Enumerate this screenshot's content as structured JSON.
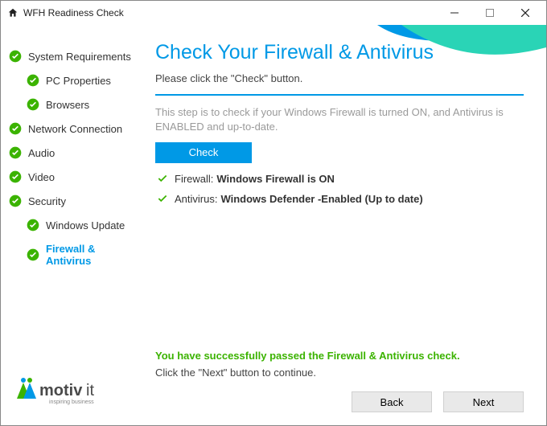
{
  "window": {
    "title": "WFH Readiness Check"
  },
  "sidebar": {
    "items": [
      {
        "label": "System Requirements"
      },
      {
        "label": "PC Properties"
      },
      {
        "label": "Browsers"
      },
      {
        "label": "Network Connection"
      },
      {
        "label": "Audio"
      },
      {
        "label": "Video"
      },
      {
        "label": "Security"
      },
      {
        "label": "Windows Update"
      },
      {
        "label": "Firewall & Antivirus"
      }
    ],
    "logo": {
      "name": "motivit",
      "tagline": "inspiring business"
    }
  },
  "main": {
    "heading": "Check Your Firewall & Antivirus",
    "subtitle": "Please click the \"Check\" button.",
    "description": "This step is to check if your Windows Firewall is turned ON, and Antivirus is ENABLED and up-to-date.",
    "check_button": "Check",
    "results": {
      "firewall": {
        "label": "Firewall:",
        "value": "Windows Firewall is ON"
      },
      "antivirus": {
        "label": "Antivirus:",
        "value": "Windows Defender -Enabled  (Up to date)"
      }
    },
    "success": "You have successfully passed the Firewall & Antivirus check.",
    "next_hint": "Click the \"Next\" button to continue.",
    "back": "Back",
    "next": "Next"
  }
}
